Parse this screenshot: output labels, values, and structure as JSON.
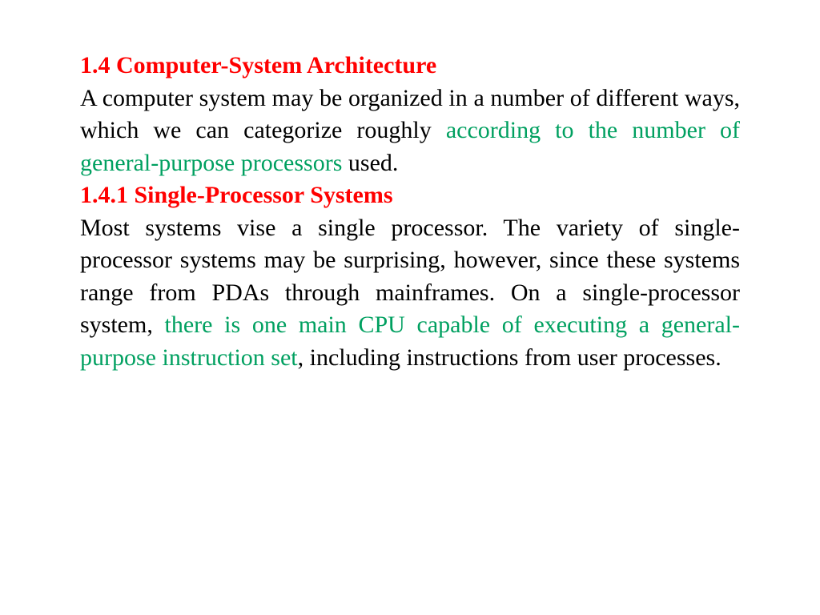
{
  "section": {
    "heading1": "1.4 Computer-System Architecture",
    "para1_part1": "A computer system may be organized in a number of different ways, which we can categorize roughly ",
    "para1_green": "according to the number of general-purpose processors",
    "para1_part2": " used.",
    "heading2": "1.4.1 Single-Processor Systems",
    "para2_part1": "Most systems vise a single processor. The variety of single-processor systems may be surprising, however, since these systems range from PDAs through mainframes. On a single-processor system, ",
    "para2_green": "there is one main CPU capable of executing a general-purpose instruction set",
    "para2_part2": ", including instructions from user processes."
  }
}
